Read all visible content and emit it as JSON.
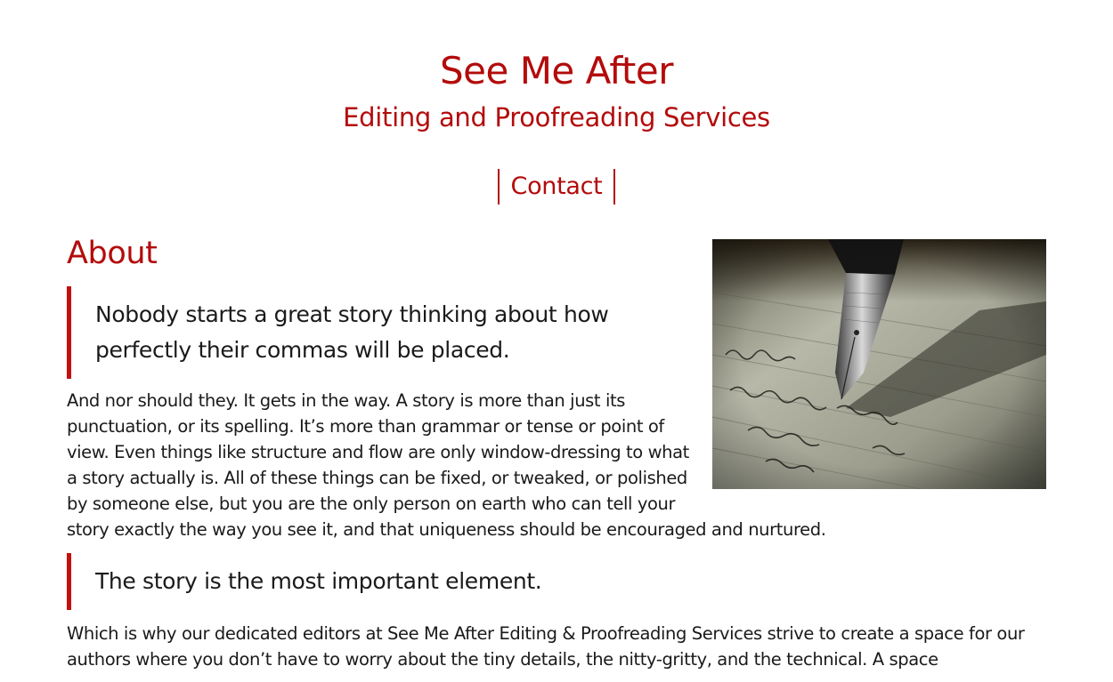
{
  "header": {
    "title": "See Me After",
    "subtitle": "Editing and Proofreading Services"
  },
  "nav": {
    "items": [
      {
        "label": "Contact"
      }
    ]
  },
  "about": {
    "heading": "About",
    "quote_1": "Nobody starts a great story thinking about how perfectly their commas will be placed.",
    "paragraph_1": "And nor should they. It gets in the way. A story is more than just its punctuation, or its spelling. It’s more than grammar or tense or point of view. Even things like structure and flow are only window-dressing to what a story actually is. All of these things can be fixed, or tweaked, or polished by someone else, but you are the only person on earth who can tell your story exactly the way you see it, and that uniqueness should be encouraged and nurtured.",
    "quote_2": "The story is the most important element.",
    "paragraph_2": "Which is why our dedicated editors at See Me After Editing & Proofreading Services strive to create a space for our authors where you don’t have to worry about the tiny details, the nitty-gritty, and the technical. A space"
  },
  "image": {
    "icon": "fountain-pen-writing-photo",
    "handwriting": "the wiracle—little thing"
  },
  "colors": {
    "accent": "#b30b0b",
    "text": "#1a1a1a",
    "background": "#ffffff"
  }
}
